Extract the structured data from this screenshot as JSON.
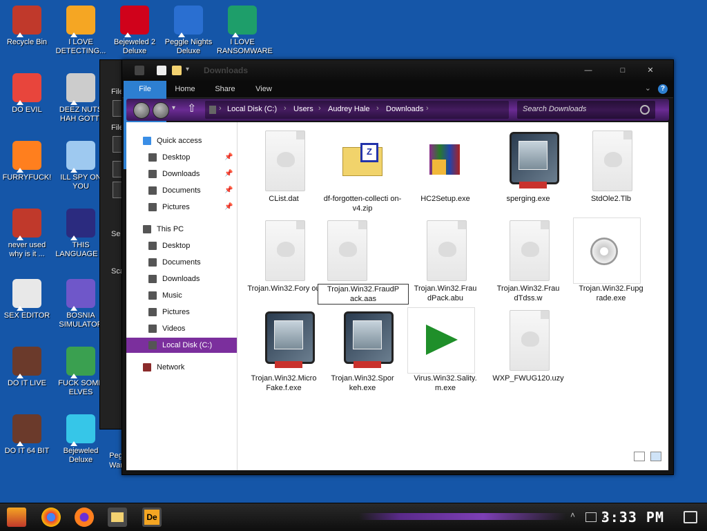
{
  "desktop": {
    "icons": [
      {
        "label": "Recycle Bin",
        "icon": "recycle-bin-icon",
        "color": "#c0392b"
      },
      {
        "label": "I LOVE DETECTING...",
        "icon": "de-app-icon",
        "color": "#f5a623"
      },
      {
        "label": "Bejeweled 2 Deluxe",
        "icon": "bejeweled2-icon",
        "color": "#d0021b"
      },
      {
        "label": "Peggle Nights Deluxe",
        "icon": "peggle-icon",
        "color": "#2a6fd1"
      },
      {
        "label": "I LOVE RANSOMWARE",
        "icon": "publisher-icon",
        "color": "#1e9e6a"
      },
      {
        "label": "DO EVIL",
        "icon": "chrome-icon",
        "color": "#e8453c"
      },
      {
        "label": "DEEZ NUTS HAH GOTTI",
        "icon": "windows-stack-icon",
        "color": "#cccccc"
      },
      {
        "label": "FURRYFUCK!",
        "icon": "firefox-icon",
        "color": "#ff7f1e"
      },
      {
        "label": "ILL SPY ON YOU",
        "icon": "spy-glass-icon",
        "color": "#9ec9f0"
      },
      {
        "label": "never used why is it ...",
        "icon": "devcpp-icon",
        "color": "#c0392b"
      },
      {
        "label": "THIS LANGUAGE ...",
        "icon": "goland-icon",
        "color": "#2b2b7f"
      },
      {
        "label": "SEX EDITOR",
        "icon": "hxd-icon",
        "color": "#e8e8e8"
      },
      {
        "label": "BOSNIA SIMULATOR",
        "icon": "virus-ball-icon",
        "color": "#6f57c9"
      },
      {
        "label": "DO IT LIVE",
        "icon": "portrait-icon",
        "color": "#6b3a2b"
      },
      {
        "label": "FUCK SOME ELVES",
        "icon": "santa-icon",
        "color": "#3aa050"
      },
      {
        "label": "DO IT 64 BIT",
        "icon": "portrait-64-icon",
        "color": "#6b3a2b"
      },
      {
        "label": "Bejeweled Deluxe",
        "icon": "diamond-icon",
        "color": "#36c6e8"
      }
    ],
    "partial_labels": [
      "Peg",
      "War"
    ]
  },
  "background_window": {
    "labels": [
      "File",
      "File",
      "Se",
      "Sca"
    ]
  },
  "explorer": {
    "title": "Downloads",
    "window_buttons": {
      "minimize": "—",
      "maximize": "□",
      "close": "✕"
    },
    "ribbon_tabs": [
      "File",
      "Home",
      "Share",
      "View"
    ],
    "help": "?",
    "address": [
      "Local Disk (C:)",
      "Users",
      "Audrey Hale",
      "Downloads"
    ],
    "search_placeholder": "Search Downloads",
    "nav": {
      "quick_access": "Quick access",
      "quick_items": [
        "Desktop",
        "Downloads",
        "Documents",
        "Pictures"
      ],
      "this_pc": "This PC",
      "pc_items": [
        "Desktop",
        "Documents",
        "Downloads",
        "Music",
        "Pictures",
        "Videos",
        "Local Disk (C:)"
      ],
      "network": "Network"
    },
    "files": [
      {
        "name": "CList.dat",
        "type": "doc"
      },
      {
        "name": "df-forgotten-collecti on-v4.zip",
        "type": "zip"
      },
      {
        "name": "HC2Setup.exe",
        "type": "winrar"
      },
      {
        "name": "sperging.exe",
        "type": "monitor"
      },
      {
        "name": "StdOle2.Tlb",
        "type": "doc"
      },
      {
        "name": "Trojan.Win32.Fory ou",
        "type": "doc"
      },
      {
        "name": "Trojan.Win32.FraudP ack.aas",
        "type": "doc",
        "renaming": true
      },
      {
        "name": "Trojan.Win32.Frau dPack.abu",
        "type": "doc"
      },
      {
        "name": "Trojan.Win32.Frau dTdss.w",
        "type": "doc"
      },
      {
        "name": "Trojan.Win32.Fupg rade.exe",
        "type": "cd"
      },
      {
        "name": "Trojan.Win32.Micro Fake.f.exe",
        "type": "monitor"
      },
      {
        "name": "Trojan.Win32.Spor keh.exe",
        "type": "monitor"
      },
      {
        "name": "Virus.Win32.Sality. m.exe",
        "type": "arrow"
      },
      {
        "name": "WXP_FWUG120.uzy",
        "type": "doc"
      }
    ]
  },
  "taskbar": {
    "items": [
      "start-icon",
      "chrome-icon",
      "firefox-icon",
      "file-explorer-icon",
      "de-app-icon"
    ],
    "clock": "3:33 PM"
  }
}
